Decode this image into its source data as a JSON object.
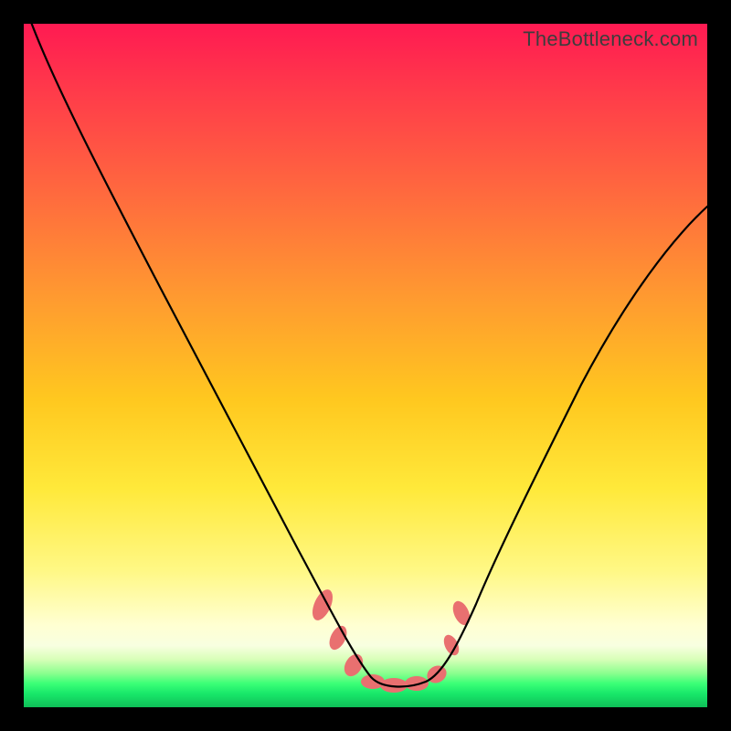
{
  "watermark": "TheBottleneck.com",
  "colors": {
    "frame": "#000000",
    "grad_top": "#ff1a52",
    "grad_mid": "#ffe93a",
    "grad_bottom": "#0fbf58",
    "marker": "#e97070",
    "line": "#000000"
  },
  "chart_data": {
    "type": "line",
    "title": "",
    "xlabel": "",
    "ylabel": "",
    "xlim": [
      0,
      100
    ],
    "ylim": [
      0,
      100
    ],
    "note": "Values estimated from pixel positions; y=100 at top, y=0 at bottom; deep V-shaped curve with flat minimum near bottom-center.",
    "series": [
      {
        "name": "curve",
        "x": [
          0,
          3,
          8,
          14,
          20,
          26,
          32,
          37,
          42,
          46,
          49,
          52,
          55,
          58,
          61,
          65,
          70,
          76,
          83,
          91,
          100
        ],
        "y": [
          100,
          94,
          84,
          73,
          62,
          51,
          40,
          30,
          20,
          12,
          6,
          3,
          3,
          3,
          6,
          12,
          22,
          35,
          49,
          62,
          73
        ]
      }
    ],
    "markers": {
      "note": "Salient salmon-colored marker clusters on the curve near the trough and shoulders (approximate).",
      "points": [
        {
          "x": 43,
          "y": 16
        },
        {
          "x": 45,
          "y": 11
        },
        {
          "x": 48,
          "y": 5
        },
        {
          "x": 50,
          "y": 3
        },
        {
          "x": 53,
          "y": 3
        },
        {
          "x": 56,
          "y": 3
        },
        {
          "x": 59,
          "y": 4
        },
        {
          "x": 62,
          "y": 10
        },
        {
          "x": 63.5,
          "y": 15
        }
      ]
    }
  }
}
